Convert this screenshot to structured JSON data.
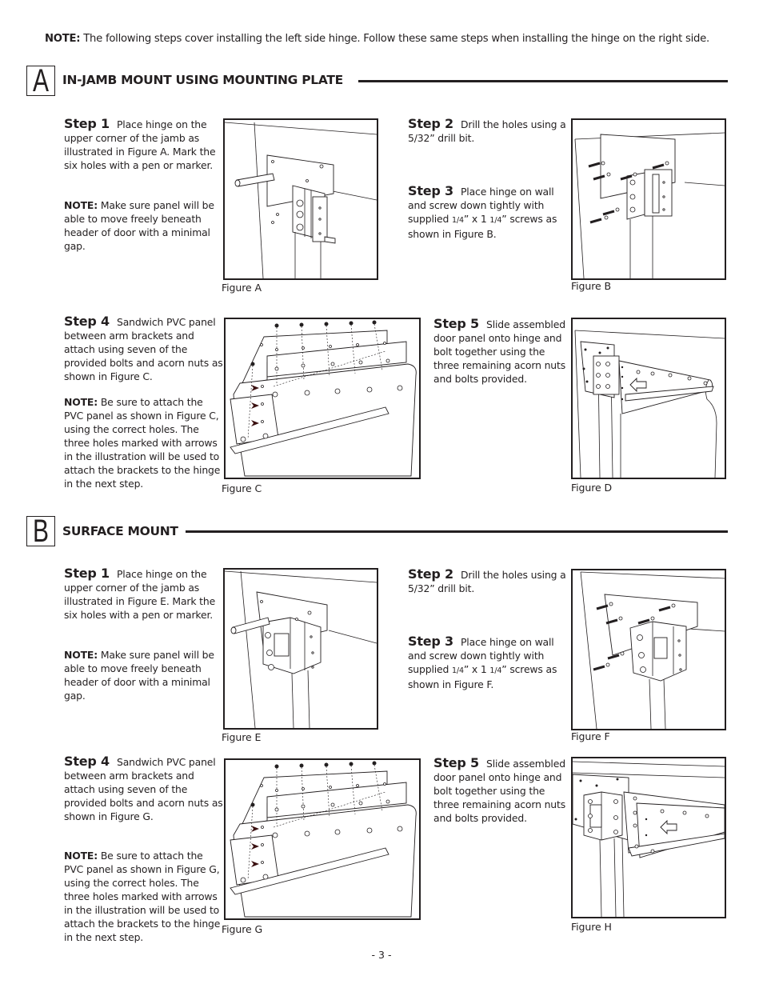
{
  "top_note": {
    "label": "NOTE:",
    "text": "The following steps cover installing the left side hinge.  Follow these same steps when installing the hinge on the right side."
  },
  "sections": [
    {
      "letter": "A",
      "title": "IN-JAMB MOUNT USING MOUNTING PLATE",
      "steps": [
        {
          "label": "Step 1",
          "text": "Place hinge on the upper corner of the jamb as illustrated in Figure A.  Mark the six holes with a pen or marker.",
          "note_label": "NOTE:",
          "note_text": "Make sure panel will be able to move freely beneath header of  door with a minimal gap."
        },
        {
          "label": "Step 2",
          "text": "Drill the holes using a 5/32” drill bit."
        },
        {
          "label": "Step 3",
          "text_before": "Place hinge on wall and screw down tightly with supplied ",
          "frac1": "1/4",
          "text_mid": "” x 1 ",
          "frac2": "1/4",
          "text_after": "” screws as shown in Figure B."
        },
        {
          "label": "Step 4",
          "text": "Sandwich PVC panel between arm brackets and attach using seven of the provided bolts and acorn nuts as shown in Figure C.",
          "note_label": "NOTE:",
          "note_text": "Be sure to attach the PVC panel as shown in Figure C, using the correct holes.  The three holes marked with arrows in the illustration will be used to attach the brackets to the hinge in the next step."
        },
        {
          "label": "Step 5",
          "text": "Slide assembled door panel onto hinge and bolt together using the three remaining acorn nuts and bolts provided."
        }
      ],
      "figures": [
        "Figure A",
        "Figure B",
        "Figure C",
        "Figure D"
      ]
    },
    {
      "letter": "B",
      "title": "SURFACE MOUNT",
      "steps": [
        {
          "label": "Step 1",
          "text": "Place hinge on the upper corner of the jamb as illustrated in Figure E.  Mark the six holes with a pen or marker.",
          "note_label": "NOTE:",
          "note_text": "Make sure panel will be able to move freely beneath header of  door with a minimal gap."
        },
        {
          "label": "Step 2",
          "text": "Drill the holes using a 5/32” drill bit."
        },
        {
          "label": "Step 3",
          "text_before": "Place hinge on wall and screw down tightly with supplied ",
          "frac1": "1/4",
          "text_mid": "” x 1 ",
          "frac2": "1/4",
          "text_after": "” screws as shown in Figure F."
        },
        {
          "label": "Step 4",
          "text": "Sandwich PVC panel between arm brackets and attach using seven of the provided bolts and acorn nuts as shown in Figure G.",
          "note_label": "NOTE:",
          "note_text": "Be sure to attach the PVC panel as shown in Figure G, using the correct holes.  The three holes marked with arrows in the illustration will be used to attach the brackets to the hinge in the next step."
        },
        {
          "label": "Step 5",
          "text": "Slide assembled door panel onto hinge and bolt together using the three remaining acorn nuts and bolts provided."
        }
      ],
      "figures": [
        "Figure E",
        "Figure F",
        "Figure G",
        "Figure H"
      ]
    }
  ],
  "page_number": "- 3 -"
}
